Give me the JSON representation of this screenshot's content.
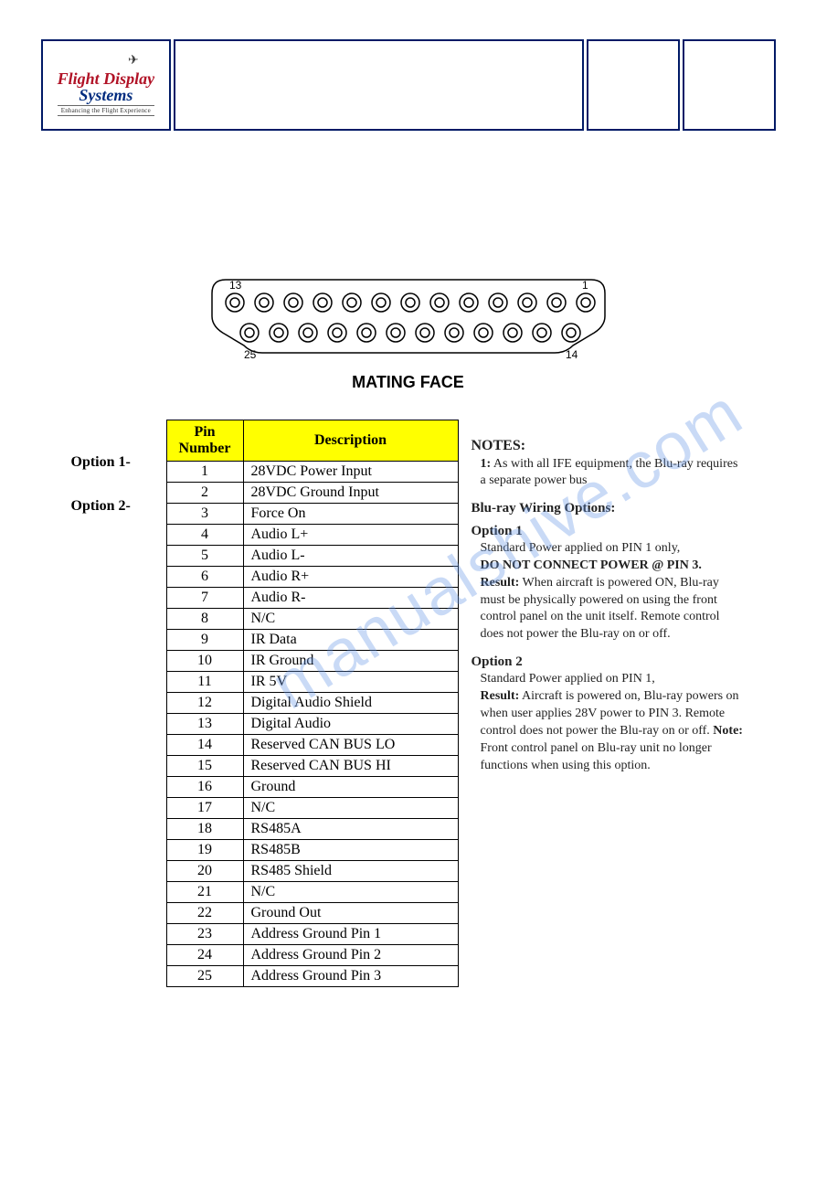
{
  "header": {
    "logo_line1": "Flight Display",
    "logo_line2": "Systems",
    "logo_tag": "Enhancing the Flight Experience"
  },
  "connector": {
    "label_13": "13",
    "label_1": "1",
    "label_25": "25",
    "label_14": "14",
    "mating_face": "MATING FACE"
  },
  "options": {
    "opt1": "Option 1-",
    "opt2": "Option 2-"
  },
  "table": {
    "head_pin": "Pin Number",
    "head_desc": "Description",
    "rows": [
      {
        "n": "1",
        "d": "28VDC Power Input"
      },
      {
        "n": "2",
        "d": "28VDC Ground Input"
      },
      {
        "n": "3",
        "d": "Force On"
      },
      {
        "n": "4",
        "d": "Audio L+"
      },
      {
        "n": "5",
        "d": "Audio L-"
      },
      {
        "n": "6",
        "d": "Audio R+"
      },
      {
        "n": "7",
        "d": "Audio R-"
      },
      {
        "n": "8",
        "d": "N/C"
      },
      {
        "n": "9",
        "d": "IR Data"
      },
      {
        "n": "10",
        "d": "IR Ground"
      },
      {
        "n": "11",
        "d": "IR 5V"
      },
      {
        "n": "12",
        "d": "Digital Audio Shield"
      },
      {
        "n": "13",
        "d": "Digital Audio"
      },
      {
        "n": "14",
        "d": "Reserved CAN BUS LO"
      },
      {
        "n": "15",
        "d": "Reserved CAN BUS HI"
      },
      {
        "n": "16",
        "d": "Ground"
      },
      {
        "n": "17",
        "d": "N/C"
      },
      {
        "n": "18",
        "d": "RS485A"
      },
      {
        "n": "19",
        "d": "RS485B"
      },
      {
        "n": "20",
        "d": "RS485 Shield"
      },
      {
        "n": "21",
        "d": "N/C"
      },
      {
        "n": "22",
        "d": "Ground Out"
      },
      {
        "n": "23",
        "d": "Address Ground Pin 1"
      },
      {
        "n": "24",
        "d": "Address Ground Pin 2"
      },
      {
        "n": "25",
        "d": "Address Ground Pin 3"
      }
    ]
  },
  "notes": {
    "title": "NOTES:",
    "n1_label": "1:",
    "n1_text": " As with all IFE equipment, the Blu-ray requires a separate power bus",
    "wiring_title": "Blu-ray Wiring Options:",
    "opt1_title": "Option 1",
    "opt1_line1": "Standard Power applied on PIN 1 only,",
    "opt1_bold": "DO NOT CONNECT POWER @ PIN 3.",
    "opt1_result_label": "Result:",
    "opt1_result_text": " When aircraft is powered ON, Blu-ray must be physically powered on using the front control panel on the unit itself. Remote control does not power the Blu-ray on or off.",
    "opt2_title": "Option 2",
    "opt2_line1": "Standard Power applied on PIN 1,",
    "opt2_result_label": "Result:",
    "opt2_result_text": " Aircraft is powered on, Blu-ray powers on when user applies 28V power to PIN 3. Remote control does not power the Blu-ray on or off. ",
    "opt2_note_label": "Note:",
    "opt2_note_text": " Front control panel on Blu-ray unit no longer functions when using this option."
  },
  "watermark": "manualshive.com"
}
